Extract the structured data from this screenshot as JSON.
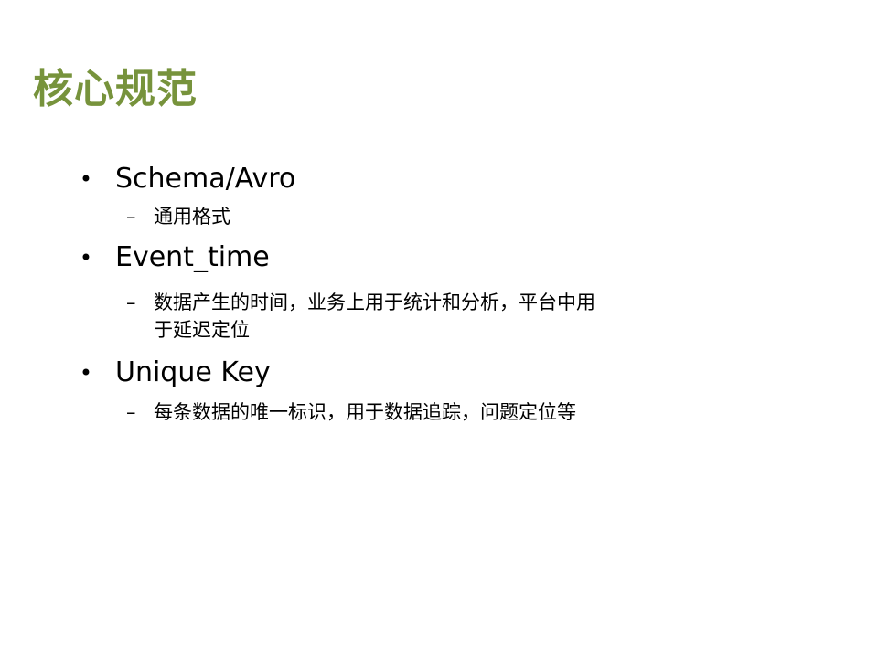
{
  "slide": {
    "title": "核心规范",
    "title_color": "#77933c",
    "bullet_glyph": "•",
    "dash_glyph": "–",
    "items": [
      {
        "label": "Schema/Avro",
        "sub": [
          "通用格式"
        ]
      },
      {
        "label": "Event_time",
        "sub": [
          "数据产生的时间，业务上用于统计和分析，平台中用",
          "于延迟定位"
        ]
      },
      {
        "label": "Unique Key",
        "sub": [
          "每条数据的唯一标识，用于数据追踪，问题定位等"
        ]
      }
    ]
  }
}
